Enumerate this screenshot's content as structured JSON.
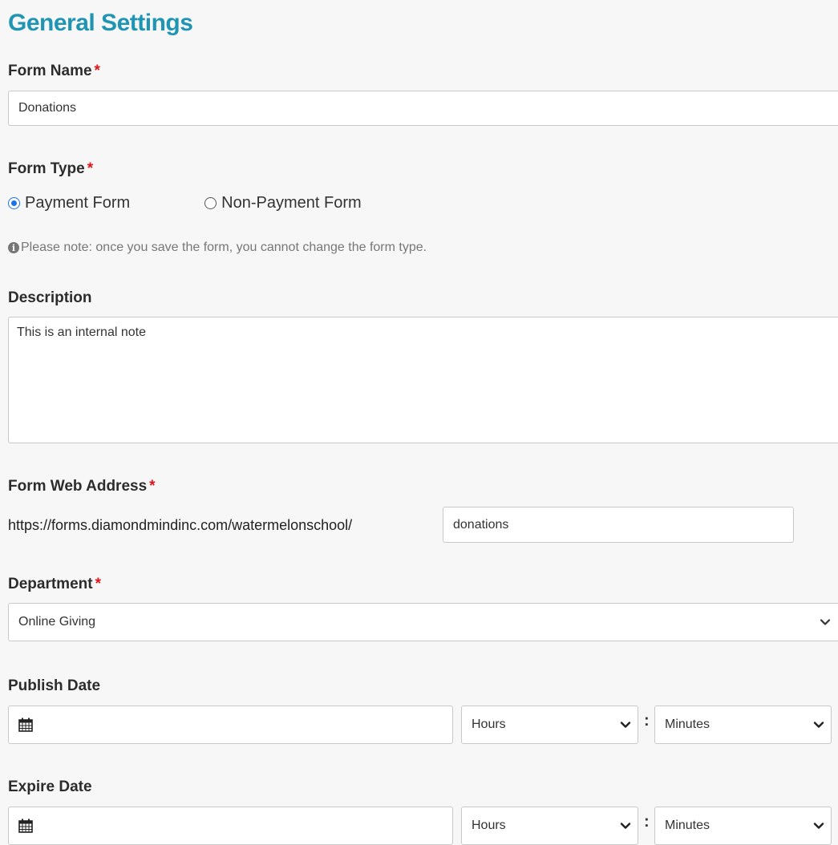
{
  "page": {
    "title": "General Settings"
  },
  "form_name": {
    "label": "Form Name",
    "required_mark": "*",
    "value": "Donations"
  },
  "form_type": {
    "label": "Form Type",
    "required_mark": "*",
    "options": [
      {
        "label": "Payment Form",
        "selected": true
      },
      {
        "label": "Non-Payment Form",
        "selected": false
      }
    ],
    "note_icon": "info-icon",
    "note": "Please note: once you save the form, you cannot change the form type."
  },
  "description": {
    "label": "Description",
    "value": "This is an internal note"
  },
  "web_address": {
    "label": "Form Web Address",
    "required_mark": "*",
    "prefix": "https://forms.diamondmindinc.com/watermelonschool/",
    "value": "donations"
  },
  "department": {
    "label": "Department",
    "required_mark": "*",
    "selected": "Online Giving"
  },
  "publish_date": {
    "label": "Publish Date",
    "date_value": "",
    "hours": "Hours",
    "separator": ":",
    "minutes": "Minutes"
  },
  "expire_date": {
    "label": "Expire Date",
    "date_value": "",
    "hours": "Hours",
    "separator": ":",
    "minutes": "Minutes"
  },
  "colors": {
    "title": "#1f95b3",
    "required": "#e0151b",
    "radio_accent": "#1a73e8",
    "background": "#f7f7f7"
  }
}
